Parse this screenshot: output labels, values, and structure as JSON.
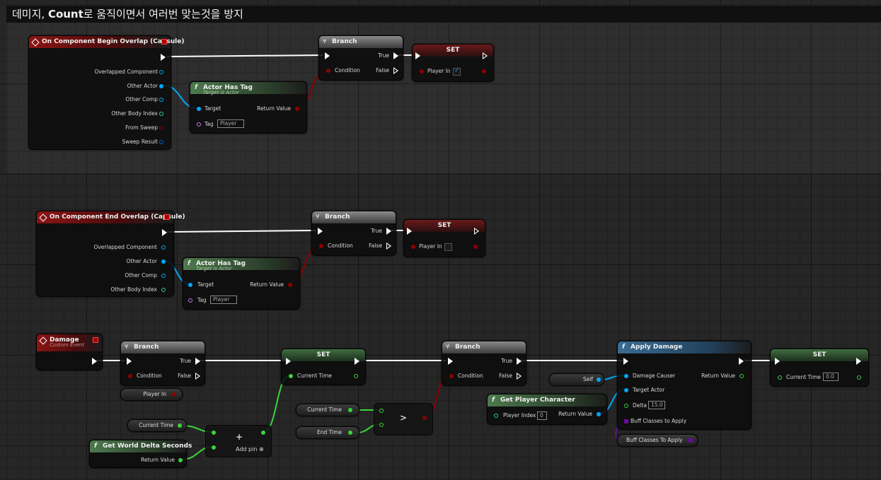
{
  "comment": {
    "title_prefix": "데미지, ",
    "title_bold": "Count",
    "title_suffix": "로 움직이면서 여러번 맞는것을 방지"
  },
  "n1": {
    "title": "On Component Begin Overlap (Capsule)",
    "pins": [
      "Overlapped Component",
      "Other Actor",
      "Other Comp",
      "Other Body Index",
      "From Sweep",
      "Sweep Result"
    ]
  },
  "n2": {
    "title": "Actor Has Tag",
    "subtitle": "Target is Actor",
    "target": "Target",
    "tag": "Tag",
    "tag_value": "Player",
    "ret": "Return Value",
    "icon": "f"
  },
  "n3": {
    "title": "Branch",
    "condition": "Condition",
    "true": "True",
    "false": "False"
  },
  "n4": {
    "title": "SET",
    "pin": "Player In"
  },
  "e1": {
    "title": "On Component End Overlap (Capsule)",
    "pins": [
      "Overlapped Component",
      "Other Actor",
      "Other Comp",
      "Other Body Index"
    ]
  },
  "e2": {
    "title": "Actor Has Tag",
    "subtitle": "Target is Actor",
    "target": "Target",
    "tag": "Tag",
    "tag_value": "Player",
    "ret": "Return Value",
    "icon": "f"
  },
  "e3": {
    "title": "Branch",
    "condition": "Condition",
    "true": "True",
    "false": "False"
  },
  "e4": {
    "title": "SET",
    "pin": "Player In"
  },
  "d1": {
    "title": "Damage",
    "subtitle": "Custom Event"
  },
  "d2": {
    "title": "Branch",
    "condition": "Condition",
    "true": "True",
    "false": "False"
  },
  "d_playerin": "Player In",
  "d3": {
    "title": "SET",
    "pin": "Current Time"
  },
  "d_curtime1": "Current Time",
  "d_worlddelta": {
    "title": "Get World Delta Seconds",
    "ret": "Return Value",
    "icon": "f"
  },
  "d_add": {
    "label": "Add pin",
    "plus": "+"
  },
  "d_curtime2": "Current Time",
  "d_endtime": "End Time",
  "d_gt": ">",
  "d4": {
    "title": "Branch",
    "condition": "Condition",
    "true": "True",
    "false": "False"
  },
  "d_self": "Self",
  "d_getplayer": {
    "title": "Get Player Character",
    "index": "Player Index",
    "index_value": "0",
    "ret": "Return Value",
    "icon": "f"
  },
  "d5": {
    "title": "Apply Damage",
    "causer": "Damage Causer",
    "target": "Target Actor",
    "delta": "Delta",
    "delta_value": "15.0",
    "buff": "Buff Classes to Apply",
    "ret": "Return Value",
    "icon": "f"
  },
  "d_buff": "Buff Classes To Apply",
  "d6": {
    "title": "SET",
    "pin": "Current Time",
    "value": "0.0"
  },
  "colors": {
    "exec": "#ffffff",
    "bool": "#8c0000",
    "object": "#00a8f4",
    "float": "#3ad33a",
    "name": "#c878f0",
    "int": "#2ad0a0",
    "struct": "#0060d0",
    "class": "#6a0aa0"
  }
}
